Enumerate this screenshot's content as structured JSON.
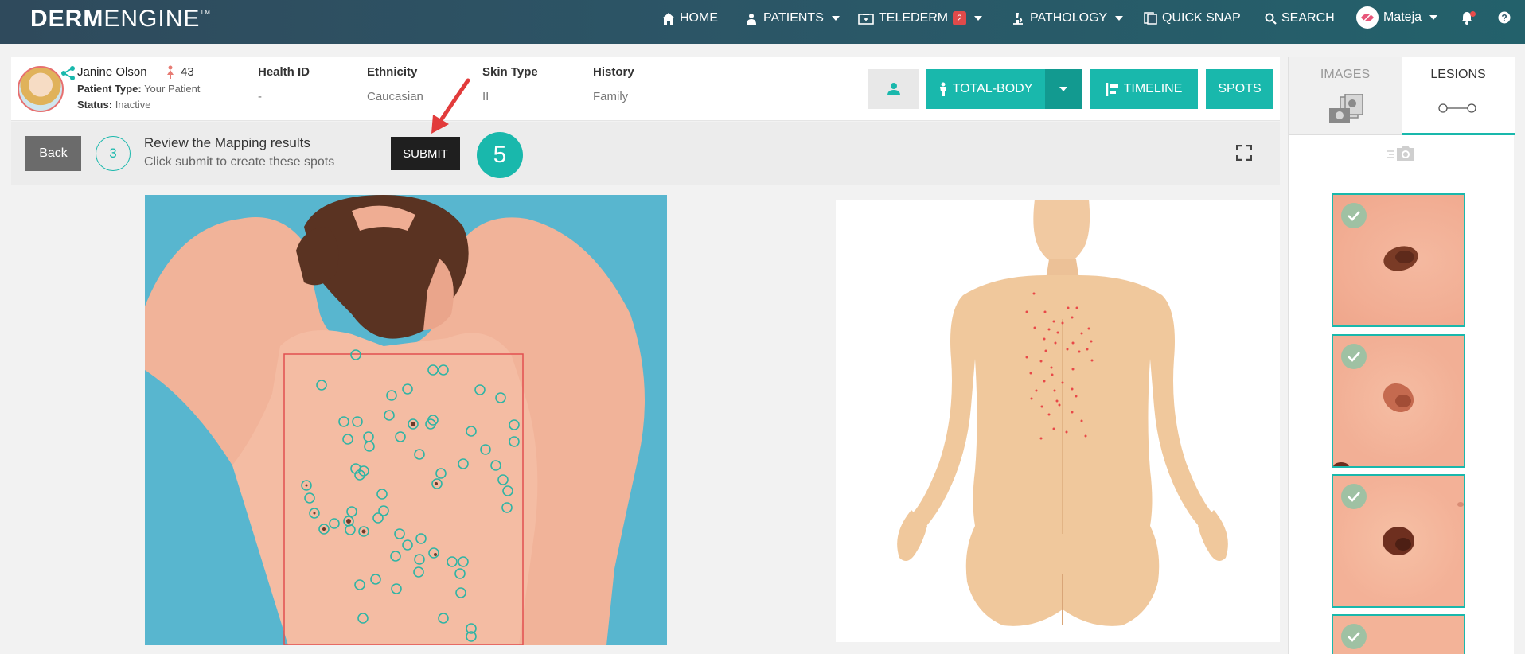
{
  "brand": {
    "name_bold": "DERM",
    "name_light": "ENGINE",
    "tm": "TM"
  },
  "nav": {
    "home": "HOME",
    "patients": "PATIENTS",
    "telederm": "TELEDERM",
    "telederm_badge": "2",
    "pathology": "PATHOLOGY",
    "quick_snap": "QUICK SNAP",
    "search": "SEARCH",
    "user": "Mateja"
  },
  "patient": {
    "name": "Janine Olson",
    "age": "43",
    "type_label": "Patient Type:",
    "type_value": "Your Patient",
    "status_label": "Status:",
    "status_value": "Inactive",
    "health_id_label": "Health ID",
    "health_id_value": "-",
    "ethnicity_label": "Ethnicity",
    "ethnicity_value": "Caucasian",
    "skin_type_label": "Skin Type",
    "skin_type_value": "II",
    "history_label": "History",
    "history_value": "Family"
  },
  "actions": {
    "total_body": "TOTAL-BODY",
    "timeline": "TIMELINE",
    "spots": "SPOTS"
  },
  "step": {
    "back": "Back",
    "number": "3",
    "title": "Review the Mapping results",
    "subtitle": "Click submit to create these spots",
    "submit": "SUBMIT",
    "annotation": "5"
  },
  "side": {
    "tab_images": "IMAGES",
    "tab_lesions": "LESIONS"
  },
  "colors": {
    "teal": "#19b8ac",
    "nav_bg": "#2c5566",
    "photo_bg": "#58b6cf",
    "marker": "#e83d4a"
  }
}
